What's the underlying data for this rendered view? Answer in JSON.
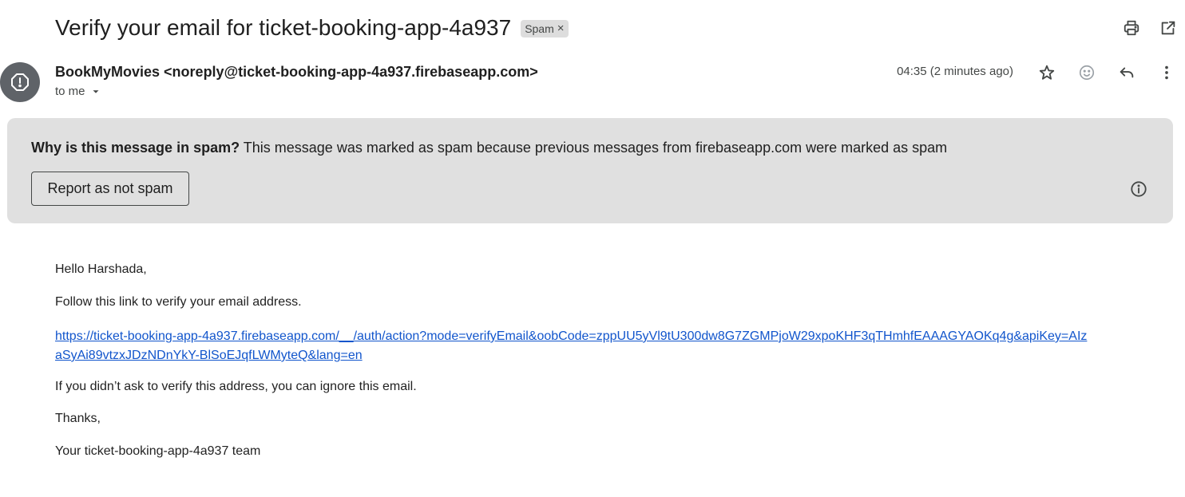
{
  "subject": {
    "text": "Verify your email for ticket-booking-app-4a937",
    "label": "Spam",
    "label_close": "×"
  },
  "top_actions": {
    "print_icon": "print-icon",
    "popout_icon": "open-in-new-window-icon"
  },
  "sender": {
    "avatar_icon": "spam-alert-icon",
    "name": "BookMyMovies",
    "email": "<noreply@ticket-booking-app-4a937.firebaseapp.com>",
    "recipient": "to me",
    "recipient_caret_icon": "caret-down-icon",
    "timestamp": "04:35 (2 minutes ago)"
  },
  "message_actions": {
    "star_icon": "star-icon",
    "emoji_icon": "emoji-reaction-icon",
    "reply_icon": "reply-icon",
    "more_icon": "more-vert-icon"
  },
  "spam_warning": {
    "question": "Why is this message in spam?",
    "reason": " This message was marked as spam because previous messages from firebaseapp.com were marked as spam",
    "button": "Report as not spam",
    "info_icon": "info-icon"
  },
  "body": {
    "greeting": "Hello Harshada,",
    "instruction": "Follow this link to verify your email address.",
    "link": "https://ticket-booking-app-4a937.firebaseapp.com/__/auth/action?mode=verifyEmail&oobCode=zppUU5yVl9tU300dw8G7ZGMPjoW29xpoKHF3qTHmhfEAAAGYAOKq4g&apiKey=AIzaSyAi89vtzxJDzNDnYkY-BlSoEJqfLWMyteQ&lang=en",
    "ignore": "If you didn’t ask to verify this address, you can ignore this email.",
    "thanks": "Thanks,",
    "signature": "Your ticket-booking-app-4a937 team"
  },
  "colors": {
    "link": "#1155cc",
    "spam_box_bg": "#e0e0e0",
    "label_bg": "#dddddd",
    "avatar_bg": "#5f6368"
  }
}
